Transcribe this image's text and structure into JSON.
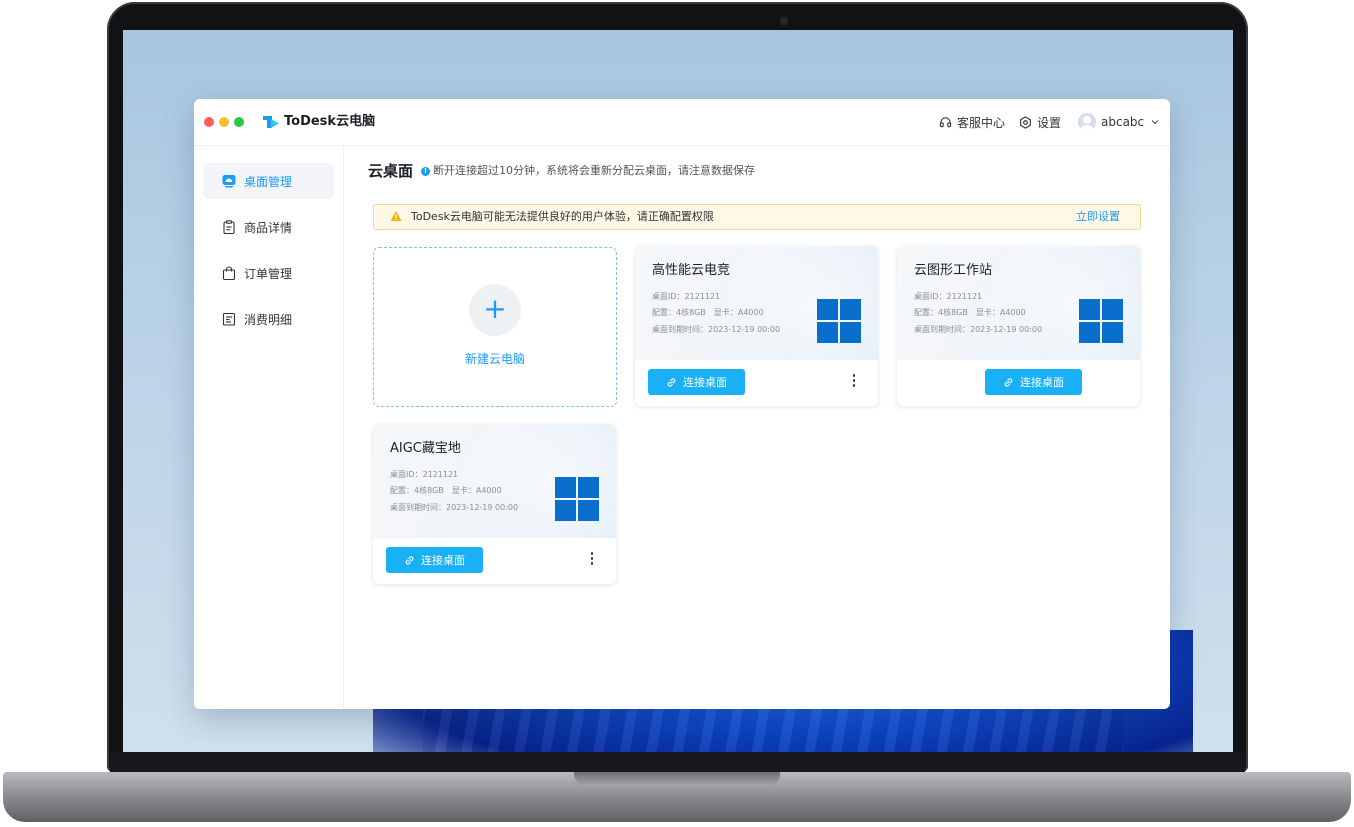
{
  "app": {
    "brand": "ToDesk云电脑",
    "header": {
      "support": "客服中心",
      "settings": "设置",
      "user": "abcabc"
    }
  },
  "sidebar": {
    "items": [
      {
        "label": "桌面管理",
        "icon": "cloud-desktop-icon",
        "active": true
      },
      {
        "label": "商品详情",
        "icon": "clipboard-icon",
        "active": false
      },
      {
        "label": "订单管理",
        "icon": "shopping-bag-icon",
        "active": false
      },
      {
        "label": "消费明细",
        "icon": "receipt-icon",
        "active": false
      }
    ]
  },
  "main": {
    "title": "云桌面",
    "note": "断开连接超过10分钟，系统将会重新分配云桌面，请注意数据保存",
    "alert": {
      "text": "ToDesk云电脑可能无法提供良好的用户体验，请正确配置权限",
      "action": "立即设置"
    },
    "new_card": {
      "label": "新建云电脑"
    },
    "cards": [
      {
        "title": "高性能云电竞",
        "desktop_id": "桌面ID：2121121",
        "config": "配置：4核8GB　显卡：A4000",
        "expiry": "桌面到期时间：2023-12-19 00:00",
        "button": "连接桌面",
        "has_more": true
      },
      {
        "title": "云图形工作站",
        "desktop_id": "桌面ID：2121121",
        "config": "配置：4核8GB　显卡：A4000",
        "expiry": "桌面到期时间：2023-12-19 00:00",
        "button": "连接桌面",
        "has_more": false
      },
      {
        "title": "AIGC藏宝地",
        "desktop_id": "桌面ID：2121121",
        "config": "配置：4核8GB　显卡：A4000",
        "expiry": "桌面到期时间：2023-12-19 00:00",
        "button": "连接桌面",
        "has_more": true
      }
    ]
  },
  "colors": {
    "accent": "#1a9cf0",
    "button": "#1ab0f5",
    "windows_logo": "#0a6fcc",
    "alert_bg": "#fff8e6"
  }
}
